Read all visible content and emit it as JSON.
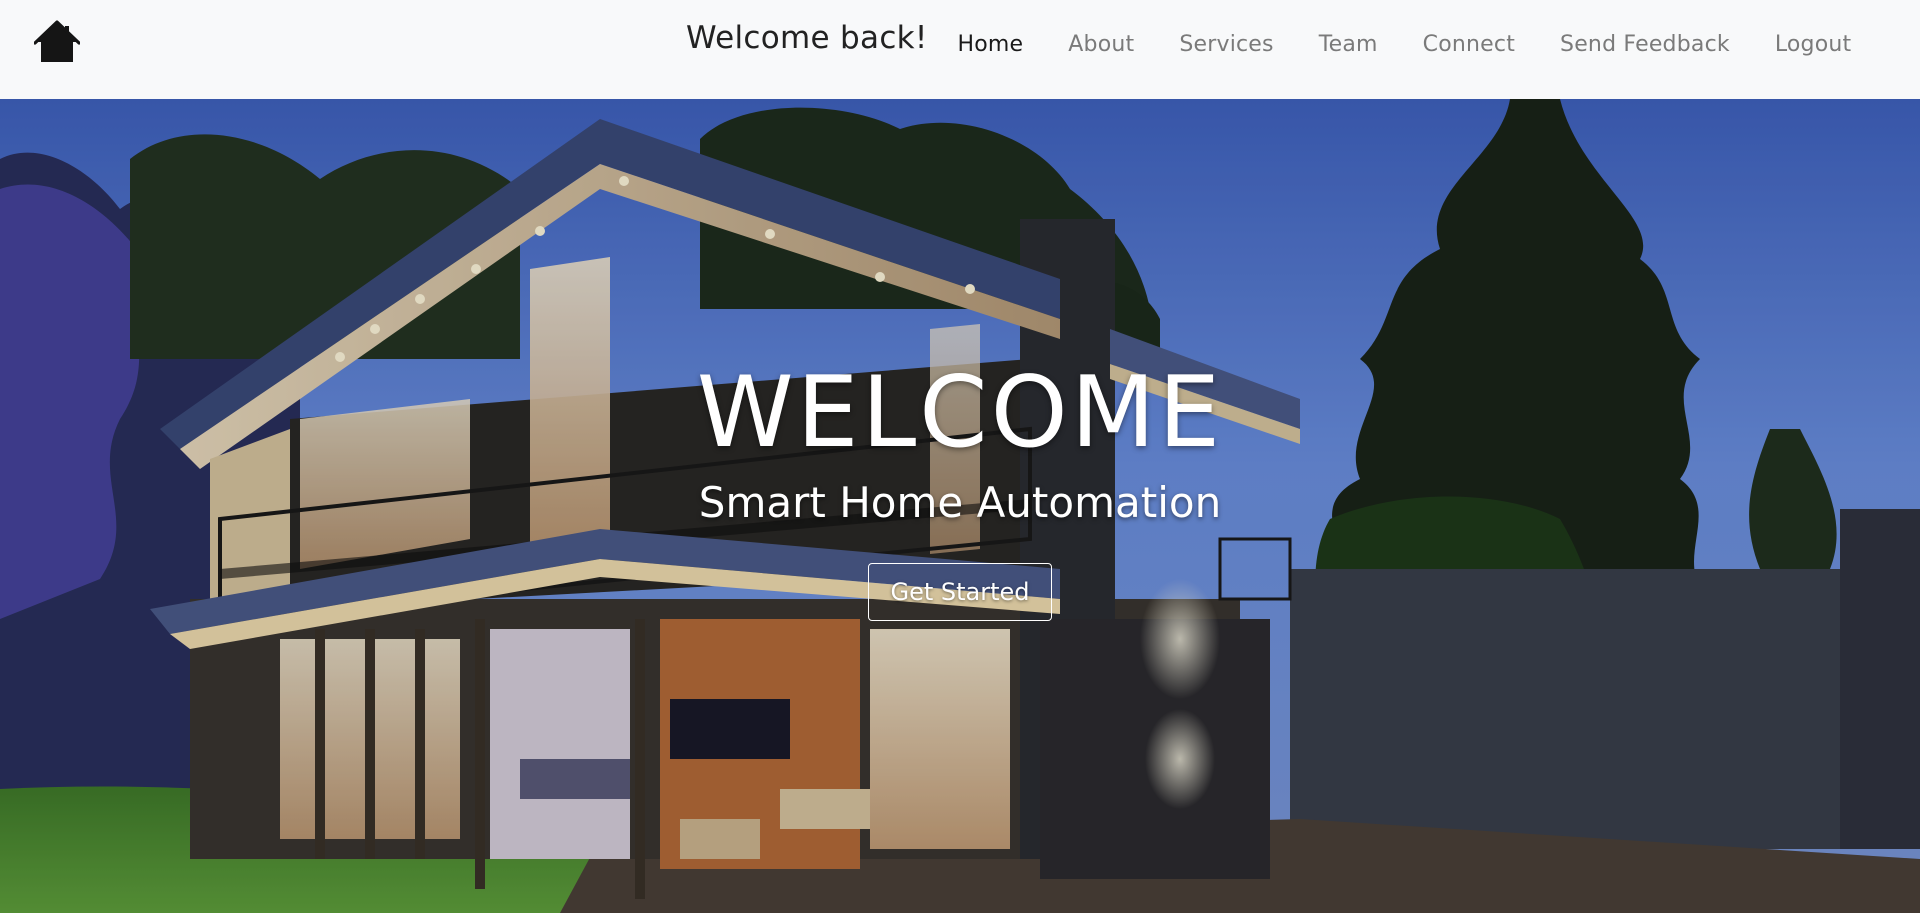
{
  "navbar": {
    "brand_icon": "home-icon",
    "greeting": "Welcome back!",
    "links": [
      {
        "label": "Home",
        "active": true
      },
      {
        "label": "About",
        "active": false
      },
      {
        "label": "Services",
        "active": false
      },
      {
        "label": "Team",
        "active": false
      },
      {
        "label": "Connect",
        "active": false
      },
      {
        "label": "Send Feedback",
        "active": false
      },
      {
        "label": "Logout",
        "active": false
      }
    ]
  },
  "hero": {
    "title": "WELCOME",
    "subtitle": "Smart Home Automation",
    "cta_label": "Get Started"
  },
  "colors": {
    "navbar_bg": "#f8f9fa",
    "active_link": "#1a1a1a",
    "inactive_link": "#7a7a7a",
    "hero_text": "#ffffff"
  }
}
